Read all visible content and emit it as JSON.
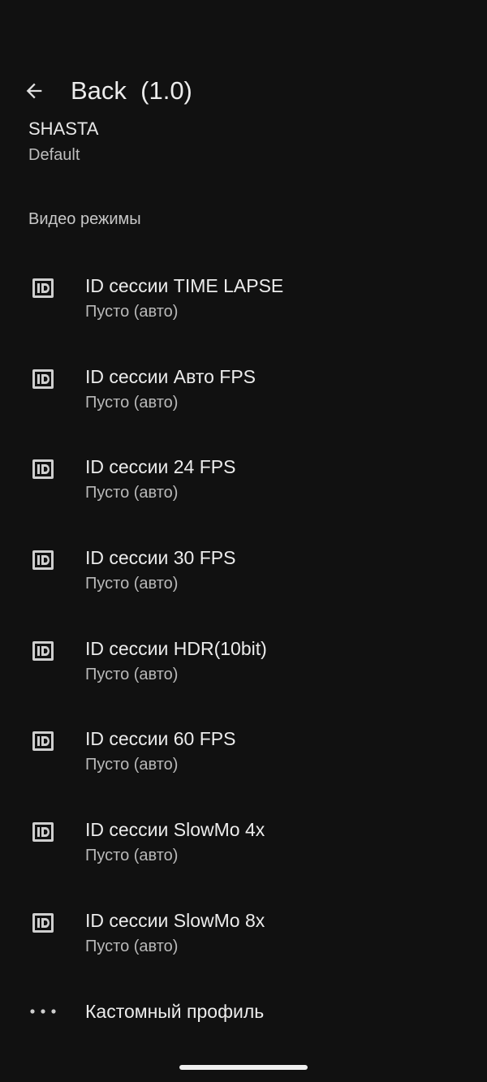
{
  "app_bar": {
    "title": "Back  (1.0)",
    "back_icon": "arrow-back-icon"
  },
  "previous_item": {
    "title": "SHASTA",
    "summary": "Default"
  },
  "section": {
    "header": "Видео режимы"
  },
  "items": [
    {
      "title": "ID сессии TIME LAPSE",
      "summary": "Пусто (авто)",
      "icon": "id-badge-icon"
    },
    {
      "title": "ID сессии Авто FPS",
      "summary": "Пусто (авто)",
      "icon": "id-badge-icon"
    },
    {
      "title": "ID сессии 24 FPS",
      "summary": "Пусто (авто)",
      "icon": "id-badge-icon"
    },
    {
      "title": "ID сессии 30 FPS",
      "summary": "Пусто (авто)",
      "icon": "id-badge-icon"
    },
    {
      "title": "ID сессии HDR(10bit)",
      "summary": "Пусто (авто)",
      "icon": "id-badge-icon"
    },
    {
      "title": "ID сессии 60 FPS",
      "summary": "Пусто (авто)",
      "icon": "id-badge-icon"
    },
    {
      "title": "ID сессии SlowMo 4x",
      "summary": "Пусто (авто)",
      "icon": "id-badge-icon"
    },
    {
      "title": "ID сессии SlowMo 8x",
      "summary": "Пусто (авто)",
      "icon": "id-badge-icon"
    }
  ],
  "custom_profile": {
    "title": "Кастомный профиль",
    "icon": "more-dots-icon"
  },
  "colors": {
    "background": "#111111",
    "text_primary": "#ececec",
    "text_secondary": "#b9b9b9"
  }
}
